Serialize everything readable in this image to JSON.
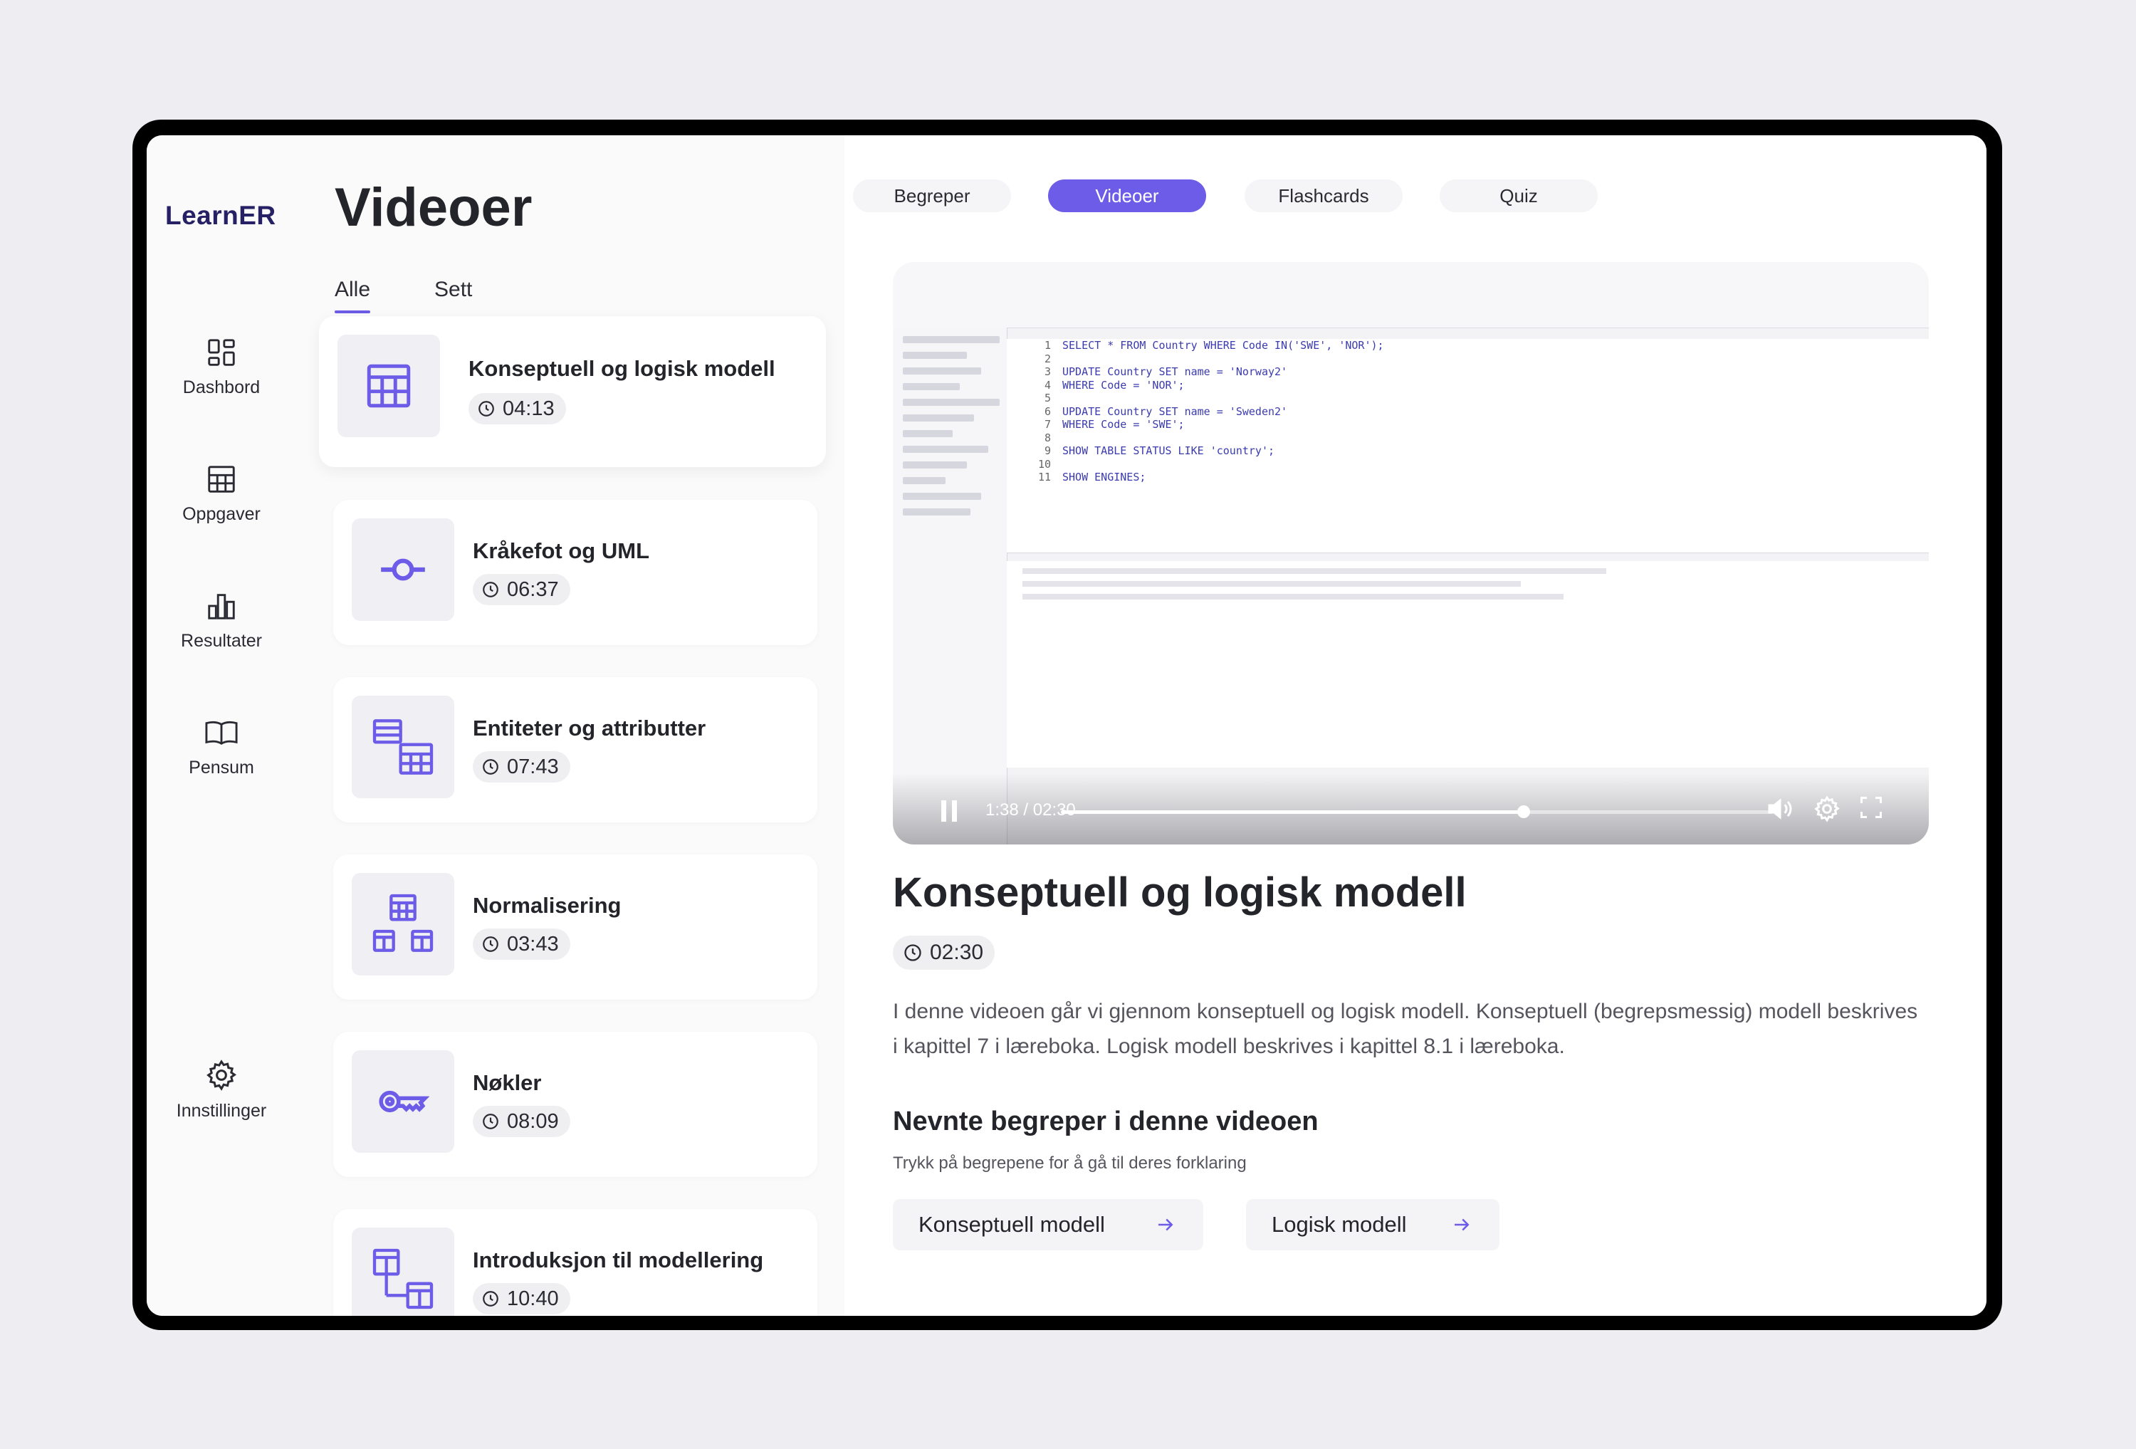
{
  "app": {
    "logo": "LearnER"
  },
  "sidebar": {
    "items": [
      {
        "label": "Dashbord",
        "icon": "dashboard-icon"
      },
      {
        "label": "Oppgaver",
        "icon": "table-icon"
      },
      {
        "label": "Resultater",
        "icon": "bar-chart-icon"
      },
      {
        "label": "Pensum",
        "icon": "book-icon"
      }
    ],
    "settings": {
      "label": "Innstillinger",
      "icon": "gear-icon"
    }
  },
  "list": {
    "title": "Videoer",
    "filters": [
      {
        "label": "Alle",
        "active": true
      },
      {
        "label": "Sett",
        "active": false
      }
    ],
    "search_icon": "search-icon",
    "videos": [
      {
        "title": "Konseptuell og logisk modell",
        "duration": "04:13",
        "icon": "table-icon",
        "active": true
      },
      {
        "title": "Kråkefot og UML",
        "duration": "06:37",
        "icon": "connector-icon"
      },
      {
        "title": "Entiteter og attributter",
        "duration": "07:43",
        "icon": "entity-table-icon"
      },
      {
        "title": "Normalisering",
        "duration": "03:43",
        "icon": "normalization-icon"
      },
      {
        "title": "Nøkler",
        "duration": "08:09",
        "icon": "key-icon"
      },
      {
        "title": "Introduksjon til modellering",
        "duration": "10:40",
        "icon": "modeling-icon"
      }
    ]
  },
  "top_tabs": [
    {
      "label": "Begreper",
      "active": false
    },
    {
      "label": "Videoer",
      "active": true
    },
    {
      "label": "Flashcards",
      "active": false
    },
    {
      "label": "Quiz",
      "active": false
    }
  ],
  "player": {
    "time": "1:38 / 02:30",
    "progress": 0.65,
    "code_lines": [
      "SELECT * FROM Country WHERE Code IN('SWE', 'NOR');",
      "",
      "UPDATE Country SET name = 'Norway2'",
      "WHERE Code = 'NOR';",
      "",
      "UPDATE Country SET name = 'Sweden2'",
      "WHERE Code = 'SWE';",
      "",
      "SHOW TABLE STATUS LIKE 'country';",
      "",
      "SHOW ENGINES;"
    ]
  },
  "detail": {
    "title": "Konseptuell og logisk modell",
    "duration": "02:30",
    "description": "I denne videoen går vi gjennom konseptuell og logisk modell. Konseptuell (begrepsmessig) modell beskrives i kapittel 7 i læreboka. Logisk modell beskrives i kapittel 8.1 i læreboka.",
    "terms_heading": "Nevnte begreper i denne videoen",
    "terms_sub": "Trykk på begrepene for å gå til deres forklaring",
    "terms": [
      "Konseptuell modell",
      "Logisk modell"
    ]
  },
  "colors": {
    "accent": "#6c5ce7",
    "logo": "#262164"
  }
}
